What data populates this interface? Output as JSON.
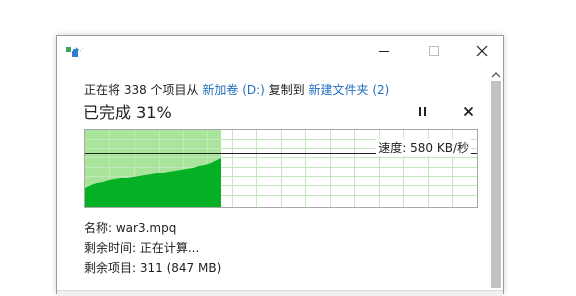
{
  "header": {
    "prefix": "正在将 338 个项目从",
    "source": "新加卷 (D:)",
    "mid": "复制到",
    "dest": "新建文件夹 (2)"
  },
  "progress": {
    "status": "已完成 31%",
    "percent": 31
  },
  "speed": {
    "label": "速度: 580 KB/秒"
  },
  "details": {
    "name": "名称: war3.mpq",
    "time_left": "剩余时间: 正在计算...",
    "items_left": "剩余项目: 311 (847 MB)"
  },
  "colors": {
    "fill": "#06b025",
    "fill_light": "#a8e49a",
    "link": "#1f6fbf"
  },
  "icons": [
    "copy-app-icon",
    "minimize-icon",
    "maximize-icon",
    "close-icon",
    "pause-icon",
    "stop-icon",
    "scroll-up-arrow-icon"
  ]
}
